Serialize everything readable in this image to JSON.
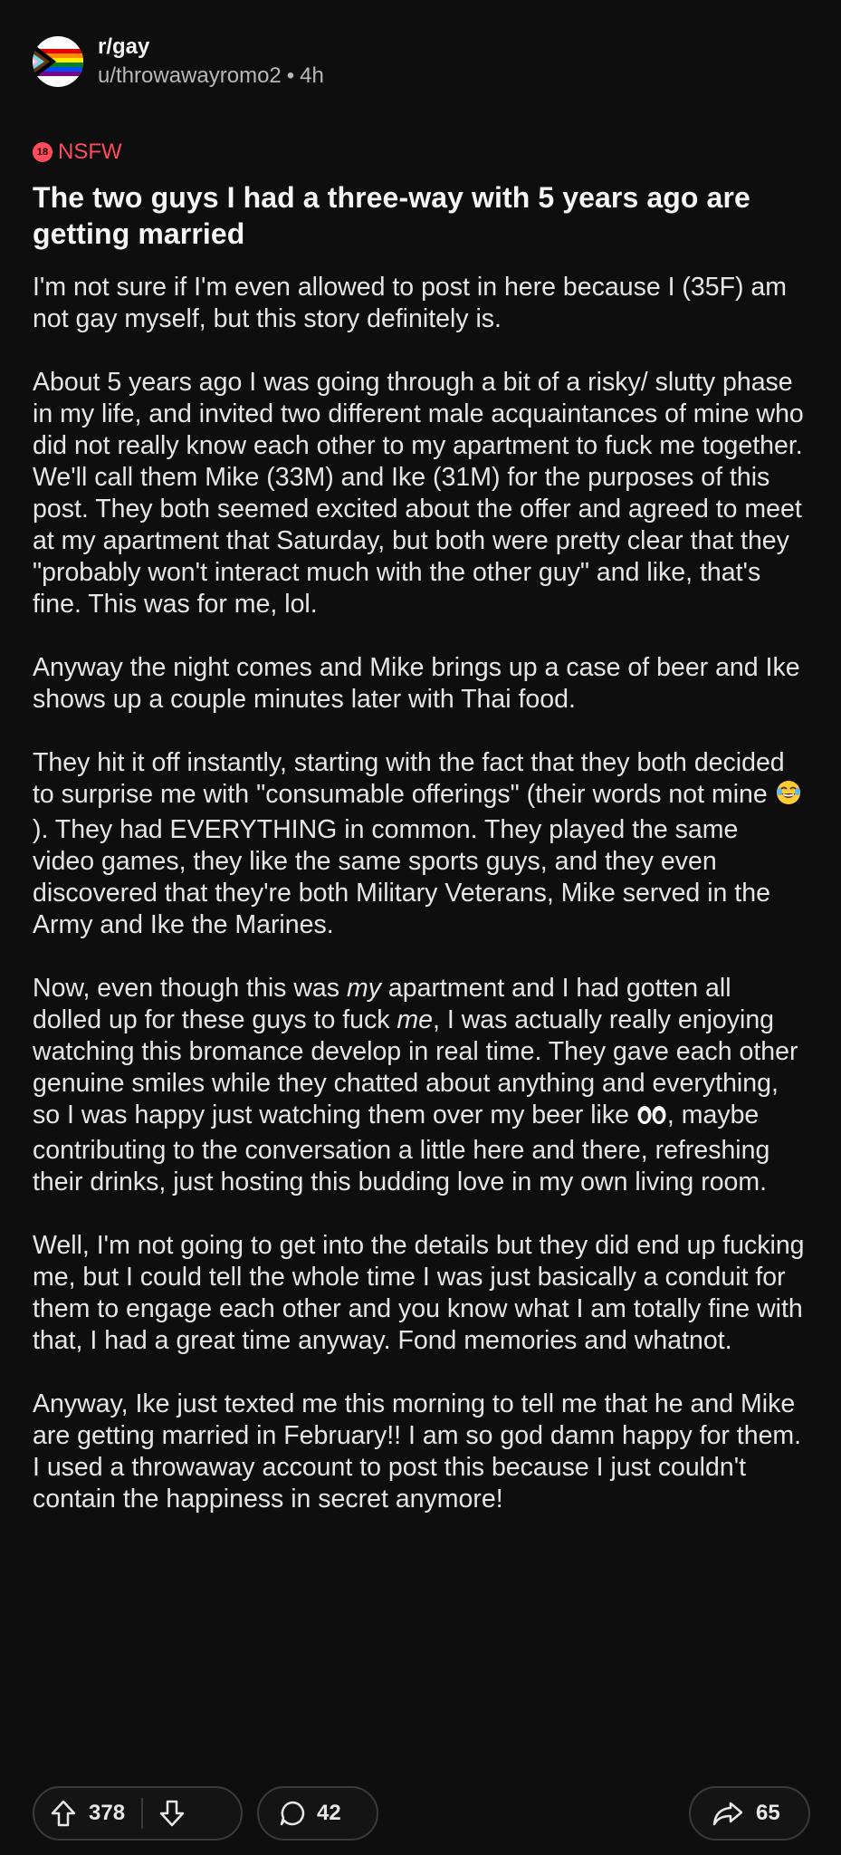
{
  "header": {
    "subreddit": "r/gay",
    "author": "u/throwawayromo2",
    "separator": "•",
    "age": "4h",
    "avatar_icon": "progress-pride-flag-icon"
  },
  "nsfw": {
    "badge": "18",
    "label": "NSFW"
  },
  "post": {
    "title": "The two guys I had a three-way with 5 years ago are getting married",
    "paragraphs": {
      "p1": "I'm not sure if I'm even allowed to post in here because I (35F) am not gay myself, but this story definitely is.",
      "p2": "About 5 years ago I was going through a bit of a risky/ slutty phase in my life, and invited two different male acquaintances of mine who did not really know each other to my apartment to fuck me together. We'll call them Mike (33M) and Ike (31M) for the purposes of this post. They both seemed excited about the offer and agreed to meet at my apartment that Saturday, but both were pretty clear that they \"probably won't interact much with the other guy\" and like, that's fine. This was for me, lol.",
      "p3": "Anyway the night comes and Mike brings up a case of beer and Ike shows up a couple minutes later with Thai food.",
      "p4a": "They hit it off instantly, starting with the fact that they both decided to surprise me with \"consumable offerings\" (their words not mine ",
      "p4b": "). They had EVERYTHING in common. They played the same video games, they like the same sports guys, and they even discovered that they're both Military Veterans, Mike served in the Army and Ike the Marines.",
      "p5a": "Now, even though this was ",
      "p5b": "my",
      "p5c": " apartment and I had gotten all dolled up for these guys to fuck ",
      "p5d": "me",
      "p5e": ", I was actually really enjoying watching this bromance develop in real time. They gave each other genuine smiles while they chatted about anything and everything, so I was happy just watching them over my beer like ",
      "p5f": ", maybe contributing to the conversation a little here and there, refreshing their drinks, just hosting this budding love in my own living room.",
      "p6": "Well, I'm not going to get into the details but they did end up fucking me, but I could tell the whole time I was just basically a conduit for them to engage each other and you know what I am totally fine with that, I had a great time anyway. Fond memories and whatnot.",
      "p7": "Anyway, Ike just texted me this morning to tell me that he and Mike are getting married in February!! I am so god damn happy for them. I used a throwaway account to post this because I just couldn't contain the happiness in secret anymore!"
    },
    "emojis": [
      "face-with-tears-of-joy-icon",
      "eyes-icon"
    ]
  },
  "actions": {
    "upvotes": "378",
    "comments": "42",
    "shares": "65",
    "icons": [
      "upvote-arrow-icon",
      "downvote-arrow-icon",
      "comment-bubble-icon",
      "share-arrow-icon"
    ]
  },
  "colors": {
    "background": "#0e0e0e",
    "text": "#e8e8e8",
    "nsfw": "#ff4b5c",
    "border": "#3a3a3a"
  }
}
